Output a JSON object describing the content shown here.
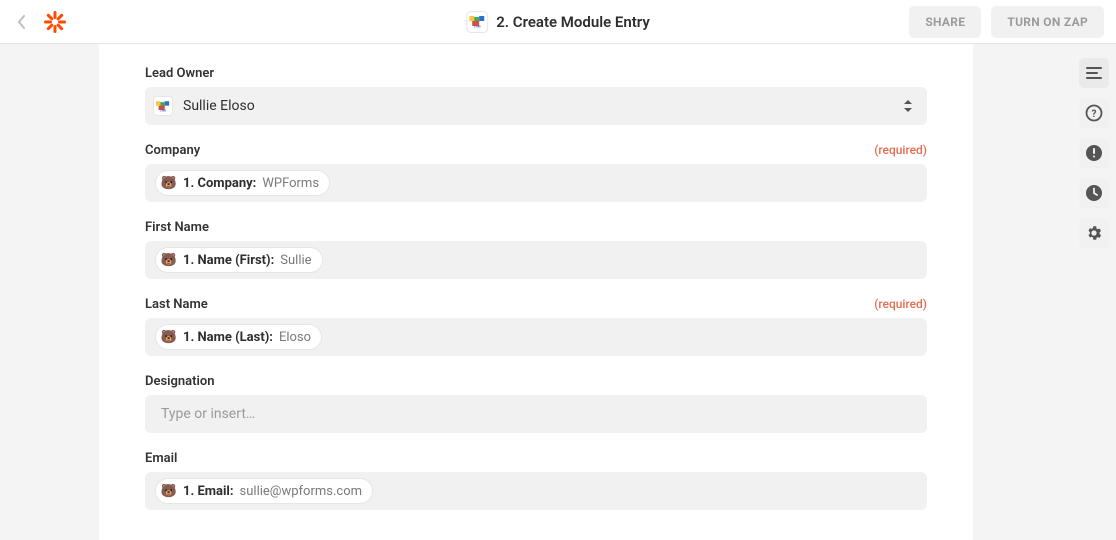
{
  "header": {
    "step_title": "2. Create Module Entry",
    "share_label": "SHARE",
    "turn_on_label": "TURN ON ZAP"
  },
  "lead_owner": {
    "label": "Lead Owner",
    "value": "Sullie Eloso"
  },
  "fields": [
    {
      "label": "Company",
      "required_text": "(required)",
      "token_label": "1. Company:",
      "token_value": "WPForms"
    },
    {
      "label": "First Name",
      "required_text": "",
      "token_label": "1. Name (First):",
      "token_value": "Sullie"
    },
    {
      "label": "Last Name",
      "required_text": "(required)",
      "token_label": "1. Name (Last):",
      "token_value": "Eloso"
    },
    {
      "label": "Designation",
      "required_text": "",
      "placeholder": "Type or insert…"
    },
    {
      "label": "Email",
      "required_text": "",
      "token_label": "1. Email:",
      "token_value": "sullie@wpforms.com"
    }
  ]
}
